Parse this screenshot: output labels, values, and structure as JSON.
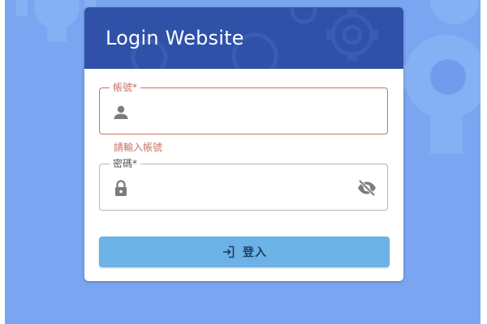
{
  "header": {
    "title": "Login Website"
  },
  "account": {
    "label": "帳號*",
    "value": "",
    "error": "請輸入帳號",
    "icon": "person-icon"
  },
  "password": {
    "label": "密碼*",
    "value": "",
    "icon": "lock-icon",
    "toggle_icon": "eye-off-icon"
  },
  "login_button": {
    "label": "登入",
    "icon": "login-icon"
  },
  "colors": {
    "background": "#7aa6f1",
    "header": "#2f51a8",
    "error": "#c6735f",
    "button": "#6cb2e6"
  }
}
